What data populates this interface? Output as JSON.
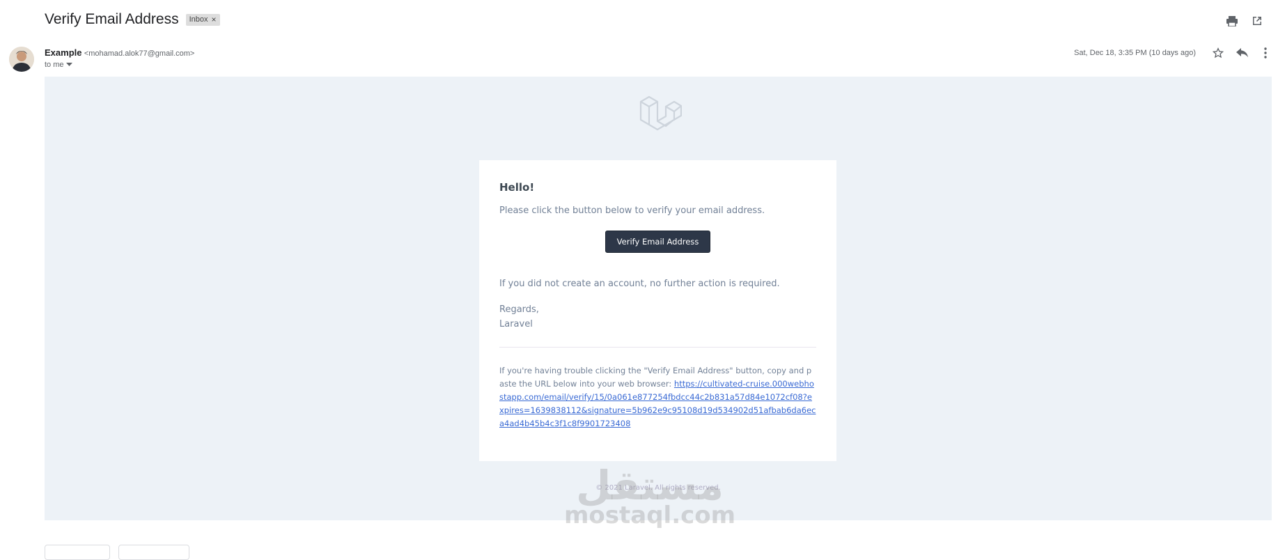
{
  "header": {
    "subject": "Verify Email Address",
    "label": "Inbox"
  },
  "message": {
    "sender_name": "Example",
    "sender_email": "<mohamad.alok77@gmail.com>",
    "to": "to me",
    "date": "Sat, Dec 18, 3:35 PM (10 days ago)"
  },
  "email": {
    "greeting": "Hello!",
    "intro": "Please click the button below to verify your email address.",
    "button_label": "Verify Email Address",
    "outro": "If you did not create an account, no further action is required.",
    "regards": "Regards,",
    "signature": "Laravel",
    "trouble_text": "If you're having trouble clicking the \"Verify Email Address\" button, copy and paste the URL below into your web browser: ",
    "url": "https://cultivated-cruise.000webhostapp.com/email/verify/15/0a061e877254fbdcc44c2b831a57d84e1072cf08?expires=1639838112&signature=5b962e9c95108d19d534902d51afbab6da6eca4ad4b45b4c3f1c8f9901723408",
    "footer": "© 2021 Laravel. All rights reserved."
  },
  "watermark": {
    "arabic": "مستقل",
    "latin": "mostaql.com"
  },
  "icons": {
    "print": "print-icon",
    "open_new": "open-in-new-window-icon",
    "star": "star-icon",
    "reply": "reply-icon",
    "more": "more-vertical-icon",
    "dropdown": "chevron-down-icon",
    "logo": "laravel-logo-icon"
  },
  "colors": {
    "email_background": "#edf2f7",
    "button": "#2d3748",
    "link": "#3869d4"
  }
}
